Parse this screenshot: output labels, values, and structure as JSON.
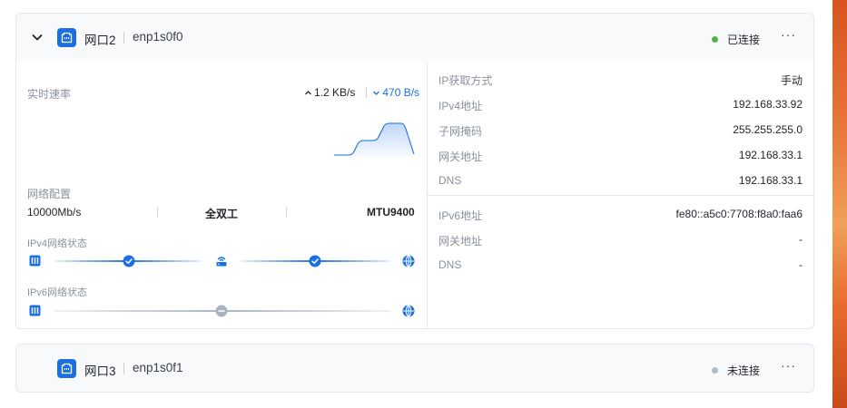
{
  "colors": {
    "accent": "#1b6fe3",
    "connected_dot": "#52b14a",
    "disconnected_dot": "#b3bcc9",
    "muted_text": "#8a919c"
  },
  "port2": {
    "name": "网口2",
    "interface": "enp1s0f0",
    "status": "已连接",
    "more": "···",
    "realtime": {
      "label": "实时速率",
      "upload": "1.2 KB/s",
      "download": "470 B/s"
    },
    "config": {
      "label": "网络配置",
      "speed": "10000Mb/s",
      "duplex": "全双工",
      "mtu": "MTU9400"
    },
    "ipv4_status_label": "IPv4网络状态",
    "ipv6_status_label": "IPv6网络状态",
    "ipv4": [
      {
        "label": "IP获取方式",
        "value": "手动"
      },
      {
        "label": "IPv4地址",
        "value": "192.168.33.92"
      },
      {
        "label": "子网掩码",
        "value": "255.255.255.0"
      },
      {
        "label": "网关地址",
        "value": "192.168.33.1"
      },
      {
        "label": "DNS",
        "value": "192.168.33.1"
      }
    ],
    "ipv6": [
      {
        "label": "IPv6地址",
        "value": "fe80::a5c0:7708:f8a0:faa6"
      },
      {
        "label": "网关地址",
        "value": "-"
      },
      {
        "label": "DNS",
        "value": "-"
      }
    ]
  },
  "port3": {
    "name": "网口3",
    "interface": "enp1s0f1",
    "status": "未连接",
    "more": "···"
  },
  "icons": {
    "expand": "chevron-down-icon",
    "port": "ethernet-port-icon",
    "device": "device-icon",
    "router": "router-icon",
    "internet": "globe-icon",
    "ok": "check-circle-icon",
    "na": "minus-circle-icon"
  }
}
